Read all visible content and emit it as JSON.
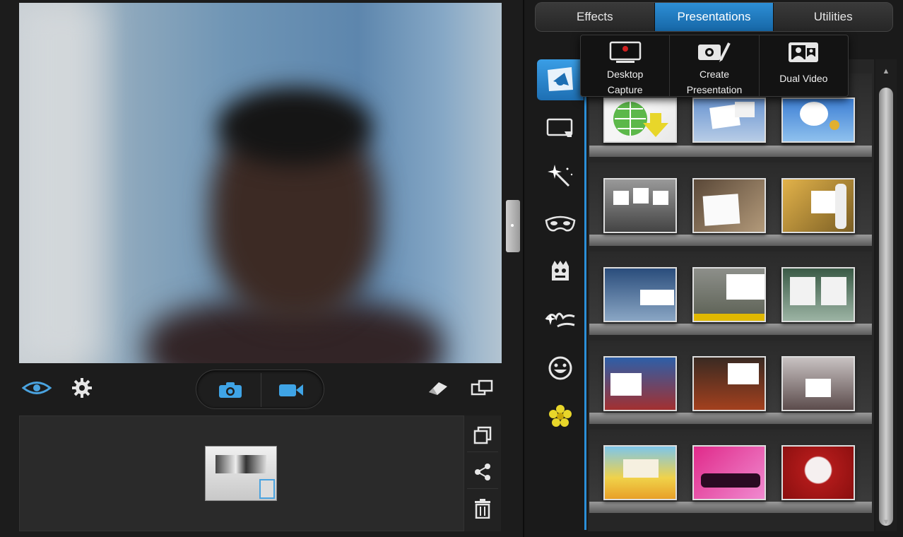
{
  "tabs": [
    {
      "label": "Effects",
      "active": false
    },
    {
      "label": "Presentations",
      "active": true
    },
    {
      "label": "Utilities",
      "active": false
    }
  ],
  "presentations_menu": [
    {
      "label": "Desktop\nCapture",
      "icon": "desktop-capture-icon"
    },
    {
      "label": "Create\nPresentation",
      "icon": "create-presentation-icon"
    },
    {
      "label": "Dual Video",
      "icon": "dual-video-icon"
    }
  ],
  "toolbar": {
    "left_icons": [
      "eye-view-icon",
      "gear-icon"
    ],
    "capture_buttons": [
      "camera-icon",
      "video-camera-icon"
    ],
    "right_icons": [
      "eraser-icon",
      "swap-screen-icon"
    ]
  },
  "library_tools": [
    "copy-icon",
    "share-icon",
    "trash-icon"
  ],
  "categories": [
    "presentation-category-icon",
    "frame-category-icon",
    "magic-wand-icon",
    "mask-icon",
    "monster-icon",
    "splash-icon",
    "smiley-icon",
    "flower-icon"
  ],
  "colors": {
    "accent": "#2b8fd8",
    "active_tab": "#1f79c1"
  }
}
